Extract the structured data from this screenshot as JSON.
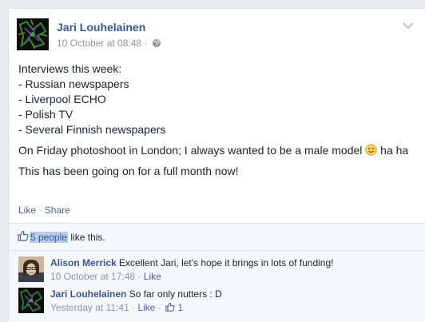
{
  "post": {
    "author": "Jari Louhelainen",
    "timestamp": "10 October at 08:48",
    "meta_separator": "·",
    "privacy_icon": "globe-icon",
    "menu_icon": "chevron-down-icon",
    "body": {
      "intro": "Interviews this week:",
      "list": [
        "- Russian newspapers",
        "- Liverpool ECHO",
        "- Polish TV",
        "- Several Finnish newspapers"
      ],
      "photoshoot": "On Friday photoshoot in London; I always wanted to be a male model",
      "photoshoot_tail": "ha ha",
      "closing": "This has been going on for a full month now!"
    },
    "actions": {
      "like": "Like",
      "separator": "·",
      "share": "Share"
    }
  },
  "likes": {
    "count_text": "5 people",
    "suffix": "like this."
  },
  "comments": [
    {
      "author": "Alison Merrick",
      "text": "Excellent Jari, let's hope it brings in lots of funding!",
      "timestamp": "10 October at 17:48",
      "separator": "·",
      "like": "Like"
    },
    {
      "author": "Jari Louhelainen",
      "text": "So far only nutters : D",
      "timestamp": "Yesterday at 11:41",
      "separator": "·",
      "like": "Like",
      "like_separator": "·",
      "like_count": "1"
    }
  ],
  "colors": {
    "link_blue": "#365899",
    "action_blue": "#4b67a1",
    "meta_gray": "#90949c",
    "text": "#1d2129",
    "ufi_bg": "#f6f7f9",
    "highlight": "#b9cbe7"
  }
}
